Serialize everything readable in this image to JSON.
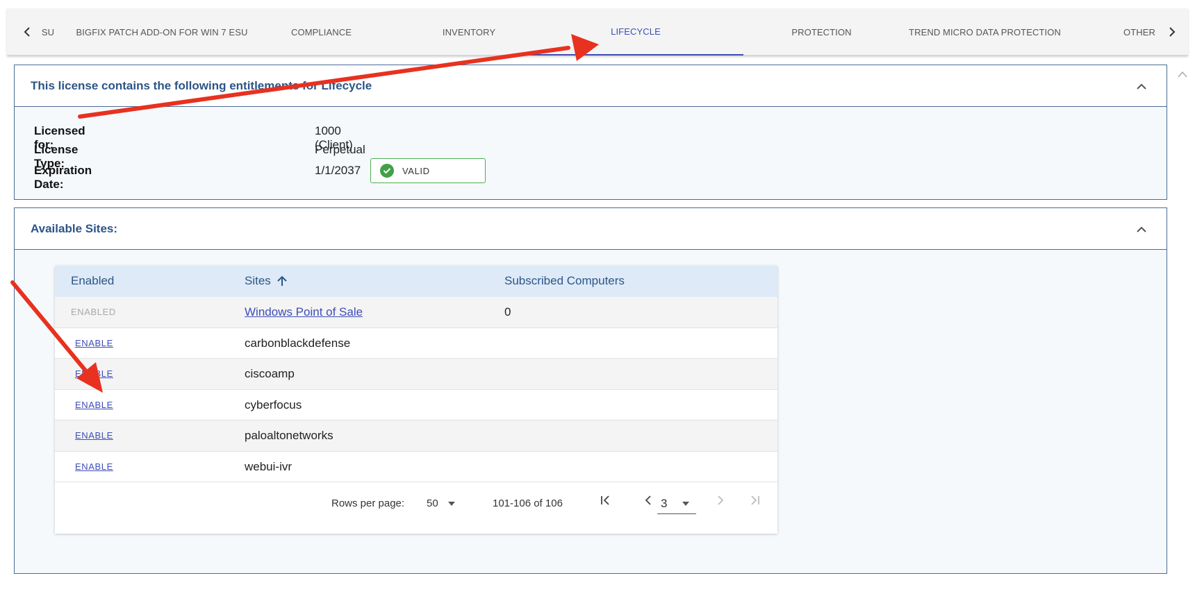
{
  "tabs": {
    "prev_label": "‹",
    "next_label": "›",
    "items": [
      {
        "label": "SU"
      },
      {
        "label": "BIGFIX PATCH ADD-ON FOR WIN 7 ESU"
      },
      {
        "label": "COMPLIANCE"
      },
      {
        "label": "INVENTORY"
      },
      {
        "label": "LIFECYCLE",
        "active": true
      },
      {
        "label": "PROTECTION"
      },
      {
        "label": "TREND MICRO DATA PROTECTION"
      },
      {
        "label": "OTHER"
      }
    ]
  },
  "license": {
    "title": "This license contains the following entitlements for Lifecycle",
    "licensed_for_label": "Licensed for:",
    "licensed_for_value": "1000 (Client)",
    "license_type_label": "License Type:",
    "license_type_value": "Perpetual",
    "expiration_label": "Expiration Date:",
    "expiration_value": "1/1/2037",
    "status": "VALID",
    "status_color": "#43a047"
  },
  "sites": {
    "title": "Available Sites:",
    "columns": [
      "Enabled",
      "Sites",
      "Subscribed Computers"
    ],
    "sort_icon": "arrow-up-icon",
    "rows": [
      {
        "enabled": "ENABLED",
        "site": "Windows Point of Sale",
        "computers": "0"
      },
      {
        "enabled": "ENABLE",
        "site": "carbonblackdefense",
        "computers": ""
      },
      {
        "enabled": "ENABLE",
        "site": "ciscoamp",
        "computers": ""
      },
      {
        "enabled": "ENABLE",
        "site": "cyberfocus",
        "computers": ""
      },
      {
        "enabled": "ENABLE",
        "site": "paloaltonetworks",
        "computers": ""
      },
      {
        "enabled": "ENABLE",
        "site": "webui-ivr",
        "computers": ""
      }
    ],
    "pagination": {
      "rows_per_page_label": "Rows per page:",
      "rows_per_page": "50",
      "range": "101-106 of 106",
      "page": "3"
    }
  },
  "colors": {
    "accent": "#3d4db7",
    "panel_title": "#2c5587",
    "annotation_arrow": "#e8311f"
  }
}
